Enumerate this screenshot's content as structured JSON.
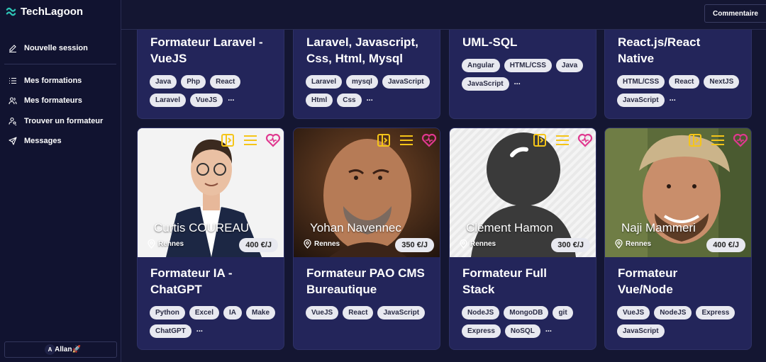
{
  "app": {
    "name": "TechLagoon"
  },
  "sidebar": {
    "new_session": "Nouvelle session",
    "items": [
      {
        "label": "Mes formations"
      },
      {
        "label": "Mes formateurs"
      },
      {
        "label": "Trouver un formateur"
      },
      {
        "label": "Messages"
      }
    ],
    "user": {
      "initial": "A",
      "name": "Allan🚀"
    }
  },
  "header": {
    "comment_label": "Commentaire"
  },
  "colors": {
    "accent_icons": "#f5c518",
    "heart": "#e0388f",
    "card_bg": "#23255a"
  },
  "top_cards": [
    {
      "title_lines": [
        "Formateur Laravel -",
        "VueJS"
      ],
      "tags": [
        "Java",
        "Php",
        "React",
        "Laravel",
        "VueJS"
      ],
      "more": "..."
    },
    {
      "title_lines": [
        "Laravel, Javascript,",
        "Css, Html, Mysql"
      ],
      "tags": [
        "Laravel",
        "mysql",
        "JavaScript",
        "Html",
        "Css"
      ],
      "more": "..."
    },
    {
      "title_lines": [
        "UML-SQL"
      ],
      "tags": [
        "Angular",
        "HTML/CSS",
        "Java",
        "JavaScript"
      ],
      "more": "..."
    },
    {
      "title_lines": [
        "React.js/React",
        "Native"
      ],
      "tags": [
        "HTML/CSS",
        "React",
        "NextJS",
        "JavaScript"
      ],
      "more": "..."
    }
  ],
  "trainers": [
    {
      "name": "Curtis COUREAU",
      "city": "Rennes",
      "price": "400 €/J",
      "title_lines": [
        "Formateur IA -",
        "ChatGPT"
      ],
      "tags": [
        "Python",
        "Excel",
        "IA",
        "Make",
        "ChatGPT"
      ],
      "more": "..."
    },
    {
      "name": "Yohan Navennec",
      "city": "Rennes",
      "price": "350 €/J",
      "title_lines": [
        "Formateur PAO CMS",
        "Bureautique"
      ],
      "tags": [
        "VueJS",
        "React",
        "JavaScript"
      ],
      "more": ""
    },
    {
      "name": "Clément Hamon",
      "city": "Rennes",
      "price": "300 €/J",
      "title_lines": [
        "Formateur Full",
        "Stack"
      ],
      "tags": [
        "NodeJS",
        "MongoDB",
        "git",
        "Express",
        "NoSQL"
      ],
      "more": "..."
    },
    {
      "name": "Naji Mammeri",
      "city": "Rennes",
      "price": "400 €/J",
      "title_lines": [
        "Formateur",
        "Vue/Node"
      ],
      "tags": [
        "VueJS",
        "NodeJS",
        "Express",
        "JavaScript"
      ],
      "more": ""
    }
  ]
}
